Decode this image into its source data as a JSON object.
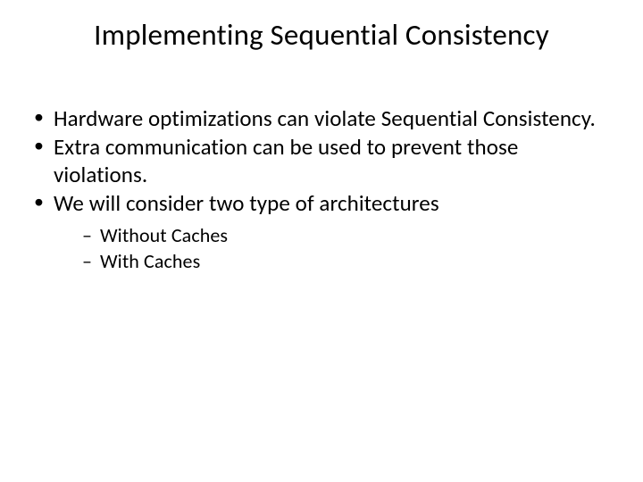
{
  "title": "Implementing Sequential Consistency",
  "bullets": [
    {
      "text": "Hardware optimizations can violate Sequential Consistency."
    },
    {
      "text": "Extra communication can be used to prevent those violations."
    },
    {
      "text": "We will consider two type of architectures"
    }
  ],
  "sub_bullets": [
    {
      "text": "Without Caches"
    },
    {
      "text": "With Caches"
    }
  ]
}
